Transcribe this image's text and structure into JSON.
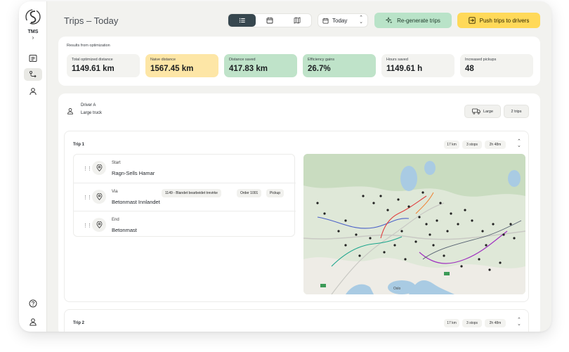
{
  "sidebar": {
    "brand": "TMS",
    "expand_glyph": "›",
    "nav_icons": [
      "list-icon",
      "route-icon",
      "user-icon"
    ],
    "bottom_icons": [
      "help-icon",
      "profile-icon"
    ]
  },
  "header": {
    "title": "Trips – Today",
    "view_modes": [
      "list-icon",
      "calendar-icon",
      "map-icon"
    ],
    "active_view": "list",
    "date_value": "Today",
    "regenerate_label": "Re-generate trips",
    "push_label": "Push trips to drivers"
  },
  "colors": {
    "accent_green": "#b9e3c8",
    "accent_yellow": "#ffd959",
    "dark": "#37474f"
  },
  "results": {
    "label": "Results from optimization",
    "metrics": [
      {
        "label": "Total optimized distance",
        "value": "1149.61 km"
      },
      {
        "label": "Naive distance",
        "value": "1567.45 km"
      },
      {
        "label": "Distance saved",
        "value": "417.83 km"
      },
      {
        "label": "Efficiency gains",
        "value": "26.7%"
      },
      {
        "label": "Hours saved",
        "value": "1149.61 h"
      },
      {
        "label": "Increased pickups",
        "value": "48"
      }
    ]
  },
  "driver": {
    "name": "Driver A",
    "vehicle": "Large truck",
    "size_label": "Large",
    "trips_label": "2 trips"
  },
  "trip1": {
    "title": "Trip 1",
    "distance": "17 km",
    "stops_count": "3 stops",
    "duration": "2h 48m",
    "stops": [
      {
        "kind": "Start",
        "name": "Ragn-Sells Hamar",
        "tags": []
      },
      {
        "kind": "Via",
        "name": "Betonmast Innlandet",
        "tags": [
          "1149 - Blandet bearbeidet trevirke",
          "Order 1001",
          "Pickup"
        ]
      },
      {
        "kind": "End",
        "name": "Betonmast",
        "tags": []
      }
    ],
    "map_label": "Oslo"
  },
  "trip2": {
    "title": "Trip 2",
    "distance": "17 km",
    "stops_count": "3 stops",
    "duration": "2h 48m"
  }
}
